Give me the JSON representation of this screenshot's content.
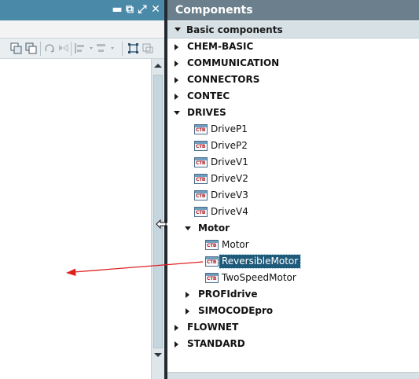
{
  "components_panel": {
    "title": "Components",
    "section": {
      "label": "Basic components",
      "expanded": true
    },
    "tree": [
      {
        "label": "CHEM-BASIC",
        "level": 0,
        "kind": "folder",
        "state": "collapsed"
      },
      {
        "label": "COMMUNICATION",
        "level": 0,
        "kind": "folder",
        "state": "collapsed"
      },
      {
        "label": "CONNECTORS",
        "level": 0,
        "kind": "folder",
        "state": "collapsed"
      },
      {
        "label": "CONTEC",
        "level": 0,
        "kind": "folder",
        "state": "collapsed"
      },
      {
        "label": "DRIVES",
        "level": 0,
        "kind": "folder",
        "state": "expanded"
      },
      {
        "label": "DriveP1",
        "level": 1,
        "kind": "block"
      },
      {
        "label": "DriveP2",
        "level": 1,
        "kind": "block"
      },
      {
        "label": "DriveV1",
        "level": 1,
        "kind": "block"
      },
      {
        "label": "DriveV2",
        "level": 1,
        "kind": "block"
      },
      {
        "label": "DriveV3",
        "level": 1,
        "kind": "block"
      },
      {
        "label": "DriveV4",
        "level": 1,
        "kind": "block"
      },
      {
        "label": "Motor",
        "level": 1,
        "kind": "folder",
        "state": "expanded"
      },
      {
        "label": "Motor",
        "level": 2,
        "kind": "block"
      },
      {
        "label": "ReversibleMotor",
        "level": 2,
        "kind": "block",
        "selected": true
      },
      {
        "label": "TwoSpeedMotor",
        "level": 2,
        "kind": "block"
      },
      {
        "label": "PROFIdrive",
        "level": 1,
        "kind": "folder",
        "state": "collapsed"
      },
      {
        "label": "SIMOCODEpro",
        "level": 1,
        "kind": "folder",
        "state": "collapsed"
      },
      {
        "label": "FLOWNET",
        "level": 0,
        "kind": "folder",
        "state": "collapsed"
      },
      {
        "label": "STANDARD",
        "level": 0,
        "kind": "folder",
        "state": "collapsed"
      }
    ],
    "block_icon_text": "CTB"
  },
  "editor_window": {
    "window_buttons": [
      {
        "name": "minimize-icon",
        "glyph": "▬"
      },
      {
        "name": "float-icon",
        "glyph": "⧉"
      },
      {
        "name": "maximize-icon",
        "glyph": "⤢"
      },
      {
        "name": "close-icon",
        "glyph": "✕"
      }
    ]
  },
  "colors": {
    "title_bar": "#4a8aa8",
    "panel_header": "#6b808c",
    "section_header": "#d6e0e5",
    "selection": "#1e5a7a",
    "annotation_arrow": "#e02020",
    "splitter": "#222a30"
  }
}
